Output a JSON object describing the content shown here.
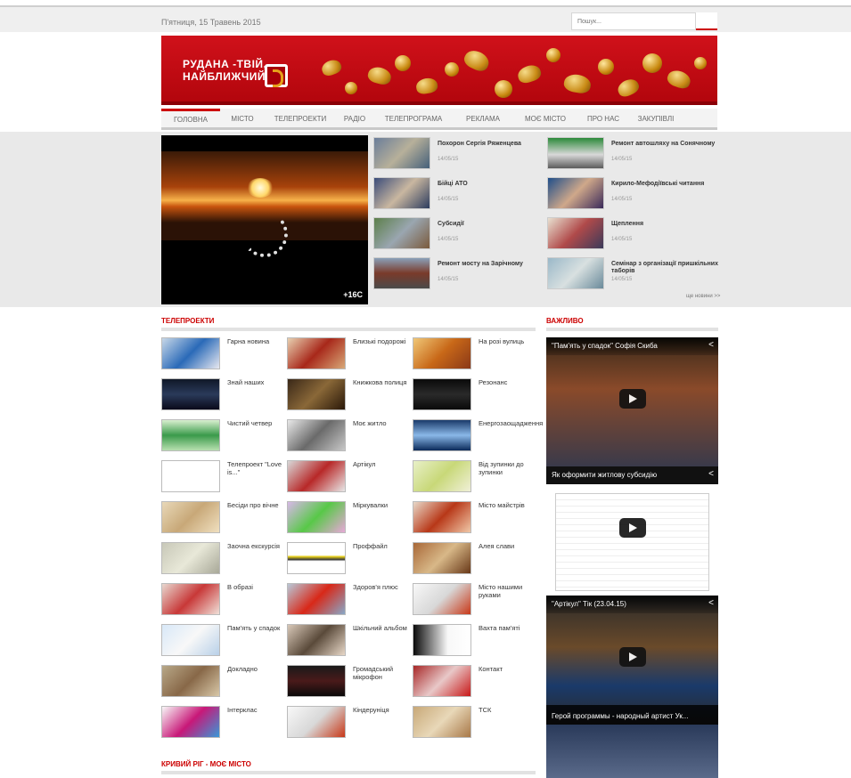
{
  "header": {
    "date": "П'ятниця, 15 Травень 2015",
    "search_placeholder": "Пошук..."
  },
  "banner": {
    "logo_line1": "РУДАНА -ТВІЙ,",
    "logo_line2": "НАЙБЛИЖЧИЙ"
  },
  "nav": {
    "items": [
      "ГОЛОВНА",
      "МІСТО",
      "ТЕЛЕПРОЕКТИ",
      "РАДІО",
      "ТЕЛЕПРОГРАМА",
      "РЕКЛАМА",
      "МОЄ МІСТО",
      "ПРО НАС",
      "ЗАКУПІВЛІ"
    ]
  },
  "feature": {
    "temperature": "+16С",
    "more": "ще новини >>"
  },
  "news": [
    {
      "title": "Похорон Сергія Ряженцева",
      "date": "14/05/15"
    },
    {
      "title": "Бійці АТО",
      "date": "14/05/15"
    },
    {
      "title": "Субсидії",
      "date": "14/05/15"
    },
    {
      "title": "Ремонт мосту на Зарічному",
      "date": "14/05/15"
    },
    {
      "title": "Ремонт автошляху на Сонячному",
      "date": "14/05/15"
    },
    {
      "title": "Кирило-Мефодіївські читання",
      "date": "14/05/15"
    },
    {
      "title": "Щеплення",
      "date": "14/05/15"
    },
    {
      "title": "Семінар з організації пришкільних таборів",
      "date": "14/05/15"
    }
  ],
  "sections": {
    "projects_title": "ТЕЛЕПРОЕКТИ",
    "important_title": "ВАЖЛИВО",
    "city_title": "КРИВИЙ РІГ - МОЄ МІСТО"
  },
  "projects": [
    "Гарна новина",
    "Близькі подорожі",
    "На розі вулиць",
    "Знай наших",
    "Книжкова полиця",
    "Резонанс",
    "Чистий четвер",
    "Моє житло",
    "Енергозаощадження",
    "Телепроект \"Love is...\"",
    "Артікул",
    "Від зупинки до зупинки",
    "Бесіди про вічне",
    "Міркувалки",
    "Місто майстрів",
    "Заочна екскурсія",
    "Проффайл",
    "Алея слави",
    "В образі",
    "Здоров'я плюс",
    "Місто нашими руками",
    "Пам'ять у спадок",
    "Шкільний альбом",
    "Вахта пам'яті",
    "Докладно",
    "Громадський мікрофон",
    "Контакт",
    "Інтерклас",
    "Кіндеруніця",
    "ТСК"
  ],
  "videos": [
    {
      "title": "\"Пам'ять у спадок\" Софія Скиба"
    },
    {
      "title": "Як оформити житлову субсидію"
    },
    {
      "title": "\"Артікул\" Тік (23.04.15)"
    },
    {
      "title": "Герой программы - народный артист Ук..."
    }
  ],
  "colors": {
    "brand_red": "#c00000",
    "banner_red": "#d0111a"
  }
}
